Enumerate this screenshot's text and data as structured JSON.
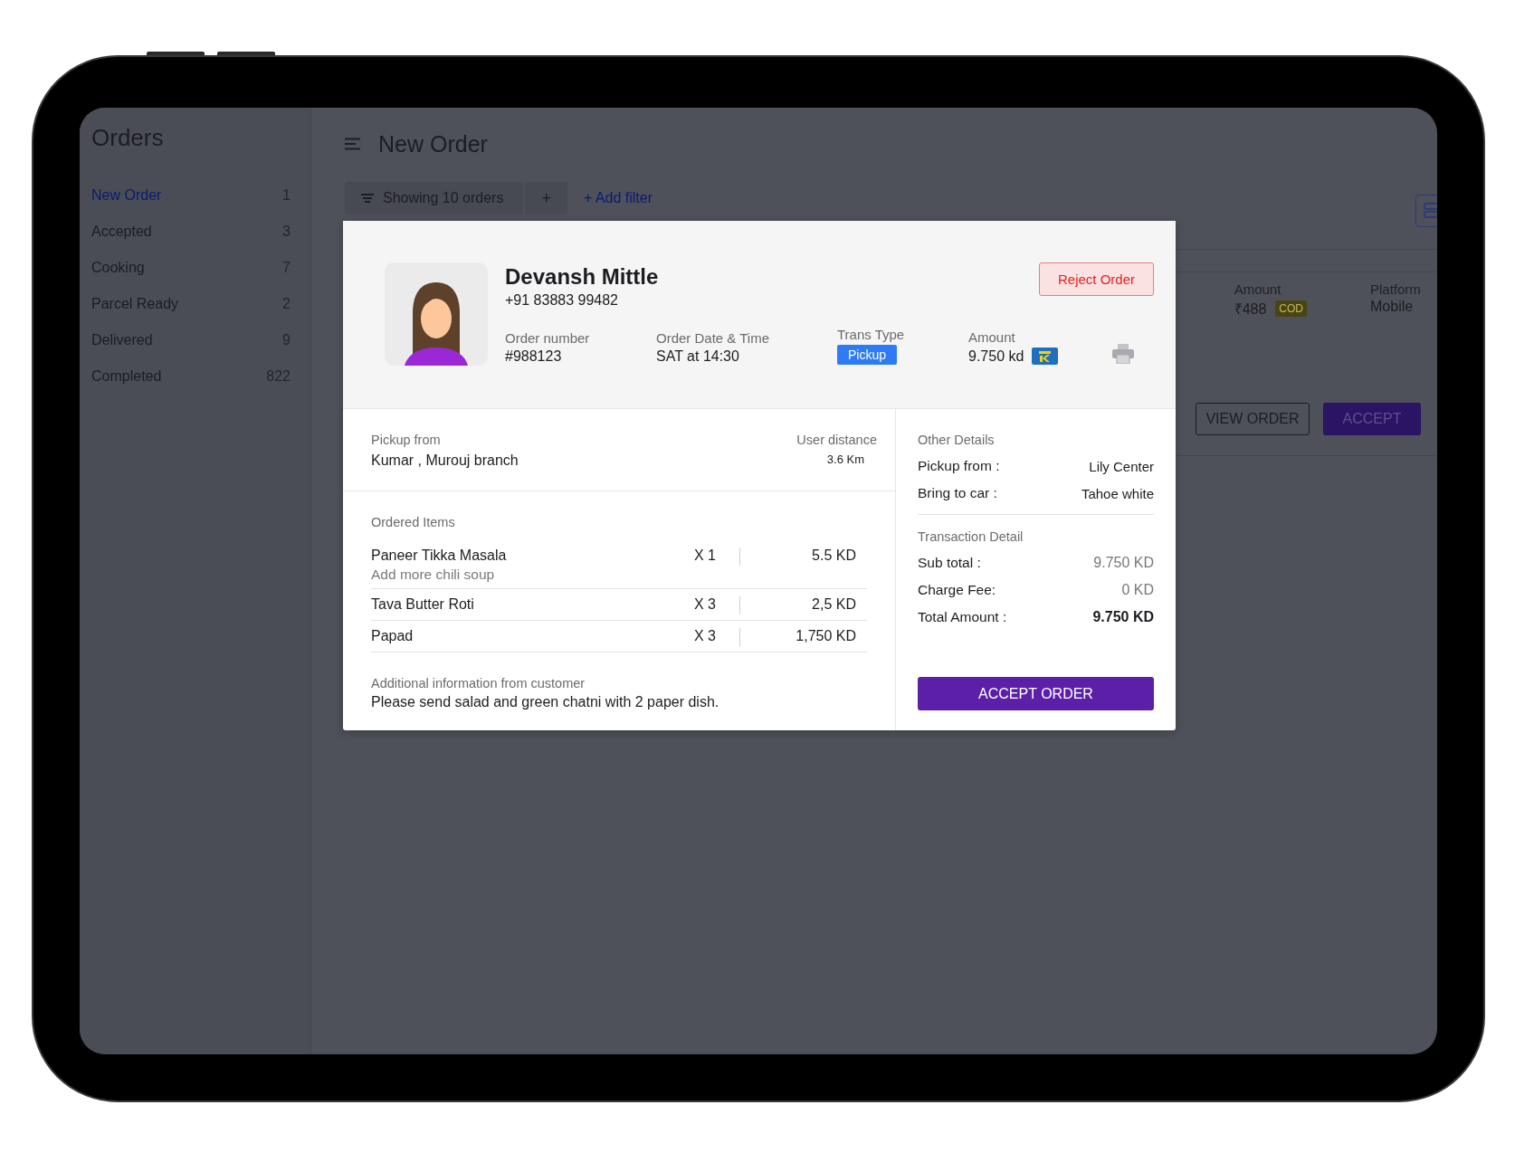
{
  "sidebar": {
    "title": "Orders",
    "items": [
      {
        "label": "New Order",
        "count": "1",
        "selected": true
      },
      {
        "label": "Accepted",
        "count": "3",
        "selected": false
      },
      {
        "label": "Cooking",
        "count": "7",
        "selected": false
      },
      {
        "label": "Parcel Ready",
        "count": "2",
        "selected": false
      },
      {
        "label": "Delivered",
        "count": "9",
        "selected": false
      },
      {
        "label": "Completed",
        "count": "822",
        "selected": false
      }
    ]
  },
  "header": {
    "title": "New Order"
  },
  "filter_bar": {
    "showing": "Showing 10 orders",
    "add": "+",
    "add_filter": "+ Add filter"
  },
  "order_row": {
    "amount_label": "Amount",
    "amount": "₹488",
    "payment_badge": "COD",
    "platform_label": "Platform",
    "platform": "Mobile",
    "buttons": [
      {
        "label": "VIEW ORDER",
        "kind": "outline"
      },
      {
        "label": "ACCEPT",
        "kind": "primary"
      }
    ]
  },
  "modal": {
    "customer": {
      "name": "Devansh Mittle",
      "phone": "+91 83883 99482"
    },
    "reject_button": "Reject Order",
    "fields": [
      {
        "label": "Order number",
        "value": "#988123",
        "kind": "text"
      },
      {
        "label": "Order Date & Time",
        "value": "SAT at 14:30",
        "kind": "text"
      },
      {
        "label": "Trans Type",
        "value": "Pickup",
        "kind": "badge"
      },
      {
        "label": "Amount",
        "value": "9.750 kd",
        "kind": "card"
      }
    ],
    "pickup": {
      "label": "Pickup from",
      "value": "Kumar , Murouj branch",
      "distance_label": "User distance",
      "distance": "3.6 Km"
    },
    "ordered_items": {
      "title": "Ordered Items",
      "items": [
        {
          "name": "Paneer Tikka Masala",
          "note": "Add more chili soup",
          "qty": "X 1",
          "price": "5.5 KD"
        },
        {
          "name": "Tava Butter Roti",
          "qty": "X 3",
          "price": "2,5 KD"
        },
        {
          "name": "Papad",
          "qty": "X 3",
          "price": "1,750 KD"
        }
      ]
    },
    "additional_info": {
      "label": "Additional information from customer",
      "text": "Please send salad and green chatni with 2 paper dish."
    },
    "other_details": {
      "title": "Other Details",
      "rows": [
        {
          "label": "Pickup from :",
          "value": "Lily Center"
        },
        {
          "label": "Bring to car :",
          "value": "Tahoe white"
        }
      ]
    },
    "transaction": {
      "title": "Transaction Detail",
      "rows": [
        {
          "label": "Sub total :",
          "value": "9.750 KD",
          "kind": "muted"
        },
        {
          "label": "Charge Fee:",
          "value": "0 KD",
          "kind": "muted"
        },
        {
          "label": "Total Amount :",
          "value": "9.750 KD",
          "kind": "total"
        }
      ]
    },
    "accept_button": "ACCEPT ORDER"
  }
}
